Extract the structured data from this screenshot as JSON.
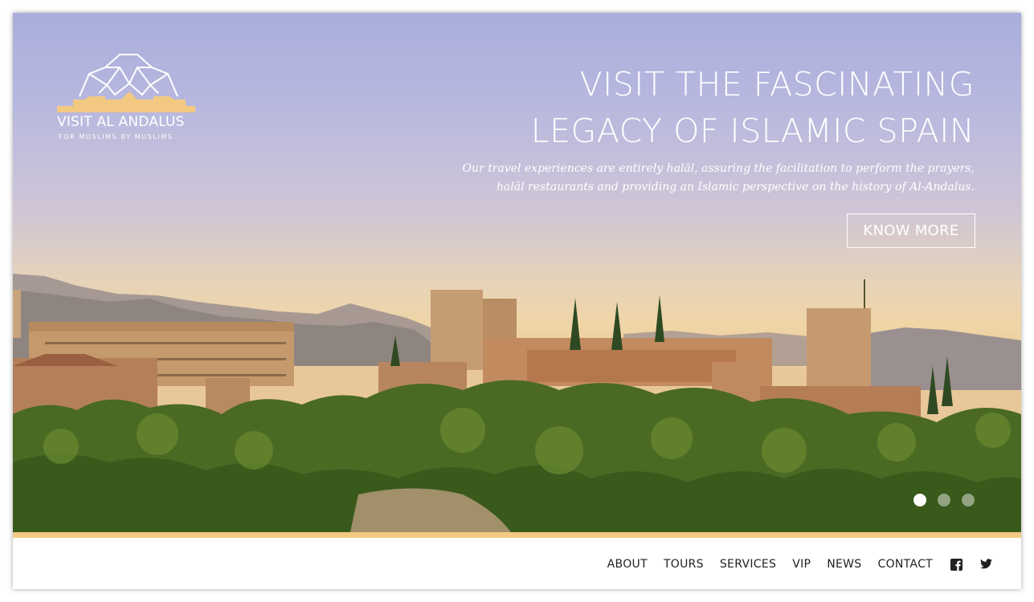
{
  "brand": {
    "name": "VISIT AL ANDALUS",
    "tagline": "FOR MUSLIMS BY MUSLIMS",
    "logo_icon": "geometric-star-logo-icon",
    "accent_color": "#f3c982"
  },
  "hero": {
    "headline_line1": "VISIT THE FASCINATING",
    "headline_line2": "LEGACY OF ISLAMIC SPAIN",
    "description_line1": "Our travel experiences are entirely halāl, assuring the facilitation to perform the prayers,",
    "description_line2": "halāl restaurants and providing an Islamic perspective on the history of Al-Andalus.",
    "cta_label": "KNOW MORE",
    "slides": [
      {
        "active": true
      },
      {
        "active": false
      },
      {
        "active": false
      }
    ]
  },
  "nav": {
    "items": [
      {
        "label": "ABOUT"
      },
      {
        "label": "TOURS"
      },
      {
        "label": "SERVICES"
      },
      {
        "label": "VIP"
      },
      {
        "label": "NEWS"
      },
      {
        "label": "CONTACT"
      }
    ],
    "social": [
      "facebook-icon",
      "twitter-icon"
    ]
  }
}
